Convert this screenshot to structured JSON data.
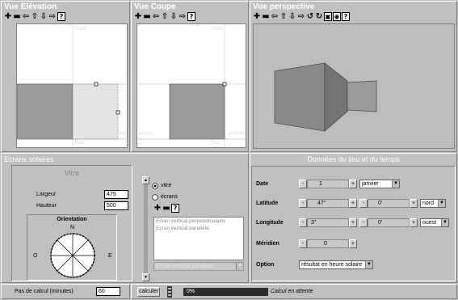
{
  "views": {
    "elevation": {
      "title": "Vue Elévation",
      "top": "haut",
      "bottom": "bas",
      "right": "droite"
    },
    "section": {
      "title": "Vue Coupe",
      "top": "haut",
      "bottom": "bas",
      "left": "avant",
      "right": "arrière"
    },
    "perspective": {
      "title": "Vue perspective"
    }
  },
  "toolbar": {
    "zoom_in": "✚",
    "zoom_out": "▬",
    "left": "⇦",
    "up": "⇧",
    "down": "⇩",
    "right": "⇨",
    "rot_left": "↺",
    "rot_right": "↻",
    "cube": "▣",
    "sphere": "◉",
    "help": "?"
  },
  "ecrans": {
    "title": "Ecrans solaires",
    "vitre_title": "Vitre",
    "largeur_label": "Largeur",
    "largeur_value": "475",
    "hauteur_label": "Hauteur",
    "hauteur_value": "500",
    "orientation_label": "Orientation",
    "compass": {
      "n": "N",
      "o": "O",
      "e": "E"
    },
    "radio_vitre": "vitre",
    "radio_ecrans": "écrans",
    "list_items": [
      "Ecran vertical perpendiculaire",
      "Ecran vertical parallèle"
    ],
    "combo_value": "Ecran vertical parallèle"
  },
  "donnees": {
    "title": "Données du lieu et du temps",
    "date_label": "Date",
    "day": "1",
    "month": "janvier",
    "latitude_label": "Latitude",
    "lat_deg": "47°",
    "lat_min": "0'",
    "lat_dir": "nord",
    "longitude_label": "Longitude",
    "lon_deg": "3°",
    "lon_min": "0'",
    "lon_dir": "ouest",
    "meridien_label": "Méridien",
    "meridien_value": "0",
    "option_label": "Option",
    "option_value": "résultat en heure solaire",
    "minus": "-",
    "plus": "+"
  },
  "status": {
    "pas_label": "Pas de calcul (minutes)",
    "pas_value": "60",
    "calc_button": "calculer",
    "progress_label": "0%",
    "progress_fraction": 0,
    "message": "Calcul en attente"
  }
}
